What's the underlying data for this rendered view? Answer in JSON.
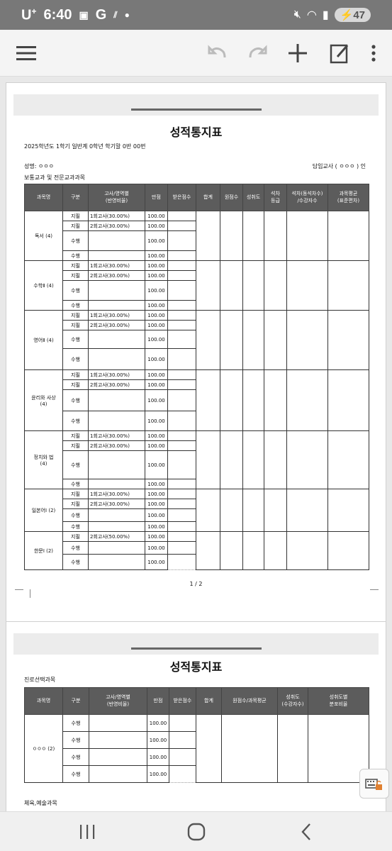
{
  "status": {
    "carrier": "U",
    "carrier_sup": "+",
    "time": "6:40",
    "g_label": "G",
    "battery": "47"
  },
  "page1": {
    "title": "성적통지표",
    "info_line": "2025학년도 1학기 일반계 0학년 학기말 0반 00번",
    "name_label": "성명: ㅇㅇㅇ",
    "teacher_label": "담임교사 ( ㅇㅇㅇ ) 인",
    "section": "보통교과 및 전문교과과목",
    "headers": [
      "과목명",
      "구분",
      "고사/영역별\n(반영비율)",
      "만점",
      "받은점수",
      "합계",
      "원점수",
      "성취도",
      "석차\n등급",
      "석차(동석차수)\n/수강자수",
      "과목평균\n(표준편차)"
    ],
    "subjects": [
      {
        "name": "독서 (4)",
        "rows": [
          {
            "type": "지필",
            "exam": "1회고사(30.00%)",
            "max": "100.00"
          },
          {
            "type": "지필",
            "exam": "2회고사(30.00%)",
            "max": "100.00"
          },
          {
            "type": "수행",
            "exam": "",
            "max": "100.00"
          },
          {
            "type": "수행",
            "exam": "",
            "max": "100.00"
          }
        ]
      },
      {
        "name": "수학Ⅱ (4)",
        "rows": [
          {
            "type": "지필",
            "exam": "1회고사(30.00%)",
            "max": "100.00"
          },
          {
            "type": "지필",
            "exam": "2회고사(30.00%)",
            "max": "100.00"
          },
          {
            "type": "수행",
            "exam": "",
            "max": "100.00"
          },
          {
            "type": "수행",
            "exam": "",
            "max": "100.00"
          }
        ]
      },
      {
        "name": "영어Ⅱ (4)",
        "rows": [
          {
            "type": "지필",
            "exam": "1회고사(30.00%)",
            "max": "100.00"
          },
          {
            "type": "지필",
            "exam": "2회고사(30.00%)",
            "max": "100.00"
          },
          {
            "type": "수행",
            "exam": "",
            "max": "100.00"
          },
          {
            "type": "수행",
            "exam": "",
            "max": "100.00"
          }
        ]
      },
      {
        "name": "윤리와 사상\n(4)",
        "rows": [
          {
            "type": "지필",
            "exam": "1회고사(30.00%)",
            "max": "100.00"
          },
          {
            "type": "지필",
            "exam": "2회고사(30.00%)",
            "max": "100.00"
          },
          {
            "type": "수행",
            "exam": "",
            "max": "100.00"
          },
          {
            "type": "수행",
            "exam": "",
            "max": "100.00"
          }
        ]
      },
      {
        "name": "정치와 법\n(4)",
        "rows": [
          {
            "type": "지필",
            "exam": "1회고사(30.00%)",
            "max": "100.00"
          },
          {
            "type": "지필",
            "exam": "2회고사(30.00%)",
            "max": "100.00"
          },
          {
            "type": "수행",
            "exam": "",
            "max": "100.00"
          },
          {
            "type": "수행",
            "exam": "",
            "max": "100.00"
          }
        ]
      },
      {
        "name": "일본어Ⅰ (2)",
        "rows": [
          {
            "type": "지필",
            "exam": "1회고사(30.00%)",
            "max": "100.00"
          },
          {
            "type": "지필",
            "exam": "2회고사(30.00%)",
            "max": "100.00"
          },
          {
            "type": "수행",
            "exam": "",
            "max": "100.00"
          },
          {
            "type": "수행",
            "exam": "",
            "max": "100.00"
          }
        ]
      },
      {
        "name": "한문Ⅰ (2)",
        "rows": [
          {
            "type": "지필",
            "exam": "2회고사(50.00%)",
            "max": "100.00"
          },
          {
            "type": "수행",
            "exam": "",
            "max": "100.00"
          },
          {
            "type": "수행",
            "exam": "",
            "max": "100.00"
          }
        ]
      }
    ],
    "page_num": "1 / 2"
  },
  "page2": {
    "title": "성적통지표",
    "section": "진로선택과목",
    "headers": [
      "과목명",
      "구분",
      "고사/영역별\n(반영비율)",
      "만점",
      "받은점수",
      "합계",
      "원점수/과목평균",
      "성취도\n(수강자수)",
      "성취도별\n분포비율"
    ],
    "subject": {
      "name": "ㅇㅇㅇ (2)",
      "rows": [
        {
          "type": "수행",
          "exam": "",
          "max": "100.00"
        },
        {
          "type": "수행",
          "exam": "",
          "max": "100.00"
        },
        {
          "type": "수행",
          "exam": "",
          "max": "100.00"
        },
        {
          "type": "수행",
          "exam": "",
          "max": "100.00"
        }
      ]
    },
    "next_section": "체육,예술과목"
  }
}
